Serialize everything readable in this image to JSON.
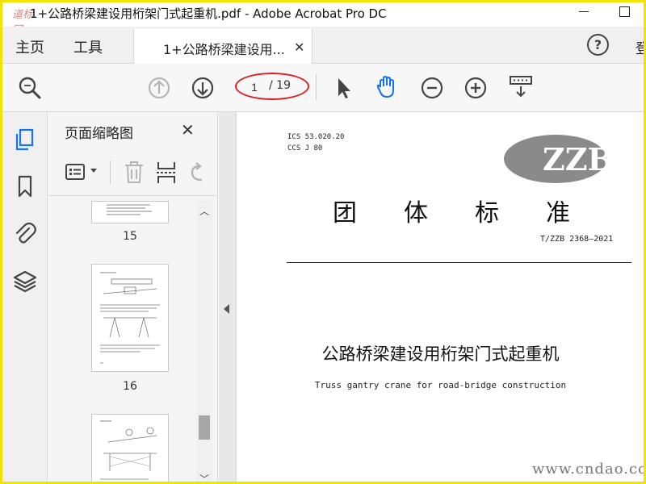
{
  "window": {
    "title": "1+公路桥梁建设用桁架门式起重机.pdf - Adobe Acrobat Pro DC"
  },
  "menu": {
    "home": "主页",
    "tools": "工具",
    "document_tab": "1+公路桥梁建设用...",
    "signin": "登"
  },
  "toolbar": {
    "current_page": "1",
    "total_pages": "/ 19",
    "icons": [
      "search-zoom-icon",
      "page-up-icon",
      "page-down-icon",
      "select-arrow-icon",
      "hand-tool-icon",
      "zoom-out-icon",
      "zoom-in-icon",
      "page-display-icon"
    ]
  },
  "thumbnail_panel": {
    "title": "页面缩略图",
    "pages": [
      {
        "label": "15"
      },
      {
        "label": "16"
      },
      {
        "label": ""
      }
    ]
  },
  "document": {
    "ics": "ICS 53.020.20",
    "ccs": "CCS J 80",
    "logo_text": "ZZB",
    "standard_type": "团体标准",
    "standard_code": "T/ZZB 2368—2021",
    "title_cn": "公路桥梁建设用桁架门式起重机",
    "title_en": "Truss gantry crane for road-bridge construction"
  },
  "watermark": {
    "site": "www.cndao.com",
    "corner": "道标网"
  },
  "colors": {
    "frame_border": "#f2e400",
    "accent_blue": "#1473e6",
    "red_annotation": "#d62222",
    "logo_gray": "#8a8a8a"
  }
}
